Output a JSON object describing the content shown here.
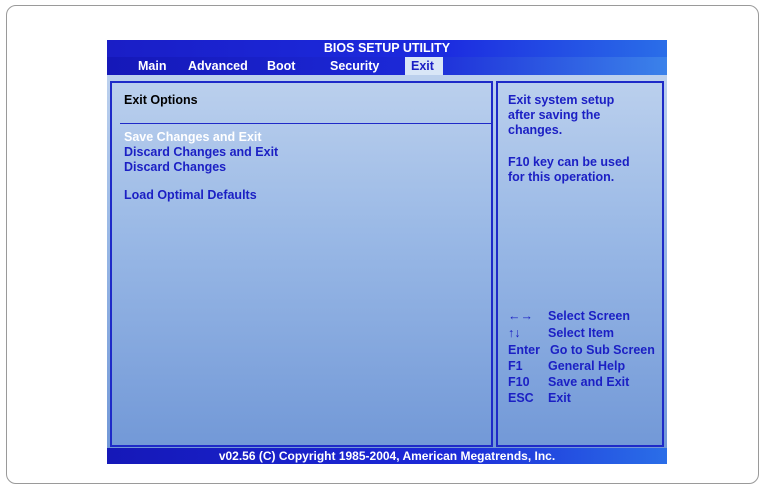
{
  "title": "BIOS SETUP UTILITY",
  "tabs": [
    {
      "label": "Main"
    },
    {
      "label": "Advanced"
    },
    {
      "label": "Boot"
    },
    {
      "label": "Security"
    },
    {
      "label": "Exit",
      "active": true
    }
  ],
  "left_pane": {
    "section_title": "Exit Options",
    "items": [
      {
        "label": "Save Changes and Exit",
        "selected": true
      },
      {
        "label": "Discard Changes and Exit"
      },
      {
        "label": "Discard Changes"
      },
      {
        "label": "Load Optimal Defaults"
      }
    ]
  },
  "help": {
    "lines1": [
      "Exit system setup",
      "after saving the",
      "changes."
    ],
    "lines2": [
      "F10 key can be used",
      "for this operation."
    ]
  },
  "keys": [
    {
      "key": "←→",
      "desc": "Select Screen"
    },
    {
      "key": "↑↓",
      "desc": "Select Item"
    },
    {
      "key": "Enter",
      "desc": "Go to Sub Screen"
    },
    {
      "key": "F1",
      "desc": "General Help"
    },
    {
      "key": "F10",
      "desc": "Save and Exit"
    },
    {
      "key": "ESC",
      "desc": "Exit"
    }
  ],
  "footer": "v02.56 (C) Copyright  1985-2004, American Megatrends, Inc.",
  "colors": {
    "bar_blue": "#1c29d8",
    "text_blue": "#1b1fc4",
    "active_tab_bg": "#d9e6f7",
    "selected_text": "#ffffff"
  }
}
